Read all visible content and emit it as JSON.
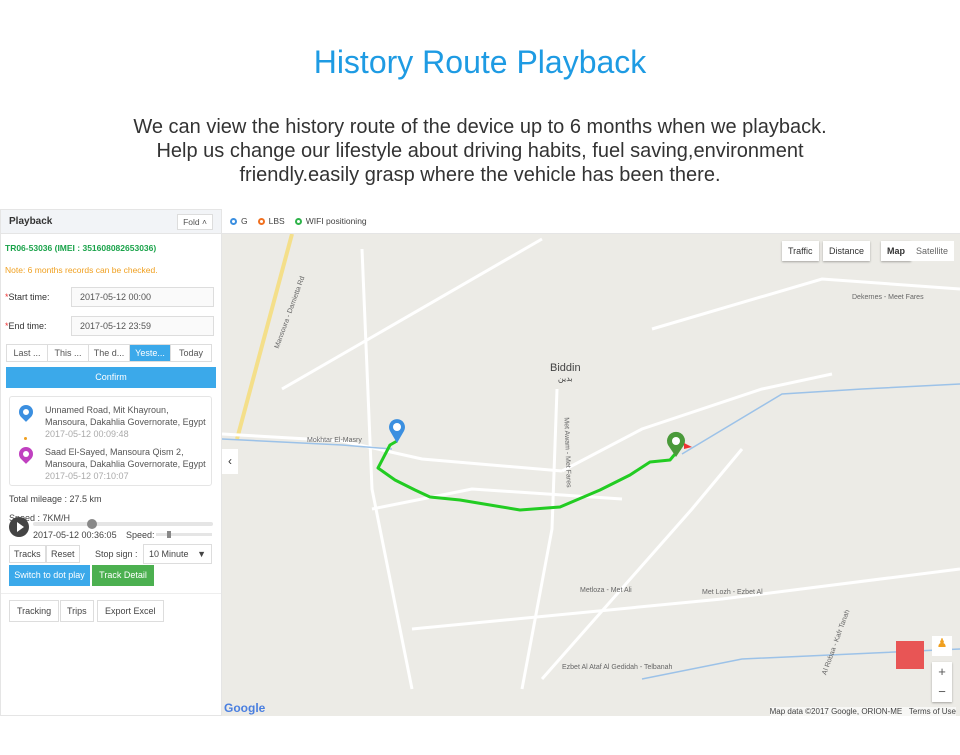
{
  "header": {
    "title": "History Route Playback",
    "description": [
      "We can view the history route of the device up to 6 months when we playback.",
      "Help us change our lifestyle about driving habits, fuel saving,environment",
      "friendly.easily grasp where the vehicle has been there."
    ]
  },
  "panel": {
    "title": "Playback",
    "fold_label": "Fold",
    "device": "TR06-53036  (IMEI : 351608082653036)",
    "note": "Note: 6 months records can be checked.",
    "start_label": "Start time:",
    "start_value": "2017-05-12 00:00",
    "end_label": "End time:",
    "end_value": "2017-05-12 23:59",
    "ranges": [
      "Last ...",
      "This ...",
      "The d...",
      "Yeste...",
      "Today"
    ],
    "active_range": 3,
    "confirm_label": "Confirm",
    "start_point": {
      "address": "Unnamed Road, Mit Khayroun, Mansoura, Dakahlia Governorate, Egypt",
      "time": "2017-05-12 00:09:48"
    },
    "end_point": {
      "address": "Saad El-Sayed, Mansoura Qism 2, Mansoura, Dakahlia Governorate, Egypt",
      "time": "2017-05-12 07:10:07"
    },
    "mileage": "Total mileage : 27.5 km",
    "speed": "Speed : 7KM/H",
    "playback_time": "2017-05-12 00:36:05",
    "speed_label": "Speed:",
    "progress": 0.33,
    "speed_level": 0.2,
    "tracks_label": "Tracks",
    "reset_label": "Reset",
    "stop_sign_label": "Stop sign :",
    "stop_sign_value": "10 Minute",
    "dot_play_label": "Switch to dot play",
    "track_detail_label": "Track Detail",
    "tracking_label": "Tracking",
    "trips_label": "Trips",
    "export_label": "Export Excel"
  },
  "map": {
    "legend": [
      {
        "label": "G",
        "color": "#3b8fe0"
      },
      {
        "label": "LBS",
        "color": "#f07020"
      },
      {
        "label": "WIFI positioning",
        "color": "#2fb34a"
      }
    ],
    "traffic_label": "Traffic",
    "distance_label": "Distance",
    "map_label": "Map",
    "satellite_label": "Satellite",
    "place": "Biddin",
    "place_ar": "بدين",
    "attribution": "Map data ©2017 Google, ORION-ME",
    "terms": "Terms of Use",
    "logo": "Google",
    "roads": [
      "Mansoura - Damietta Rd",
      "Mokhtar El-Masry",
      "Met Awam - Met Fares",
      "Dekernes - Meet Fares",
      "Metloza - Met Ali",
      "Ezbet Al Ataf Al Gedidah - Telbanah",
      "Al Robaa - Kafr Tanah",
      "Met Lozh - Ezbet Al"
    ],
    "route_color": "#22cc22"
  }
}
